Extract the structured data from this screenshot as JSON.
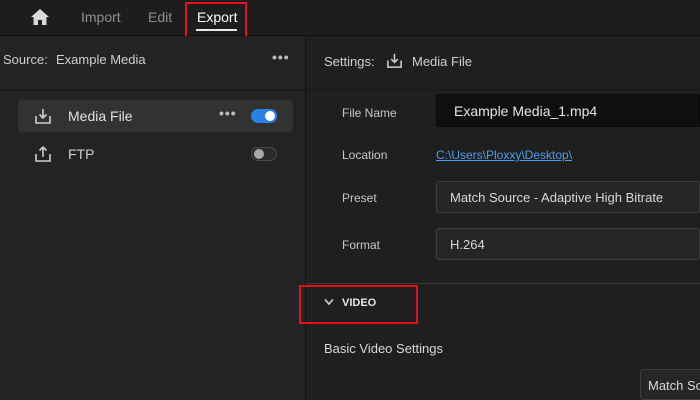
{
  "nav": {
    "home_icon": "home-icon",
    "import_label": "Import",
    "edit_label": "Edit",
    "export_label": "Export"
  },
  "source": {
    "label": "Source:",
    "value": "Example Media",
    "more": "•••"
  },
  "destinations": [
    {
      "label": "Media File",
      "icon": "download-icon",
      "enabled": true,
      "more": "•••"
    },
    {
      "label": "FTP",
      "icon": "upload-icon",
      "enabled": false
    }
  ],
  "settings": {
    "label": "Settings:",
    "destination": "Media File",
    "file_name_label": "File Name",
    "file_name_value": "Example Media_1.mp4",
    "location_label": "Location",
    "location_value": "C:\\Users\\Ploxxy\\Desktop\\",
    "preset_label": "Preset",
    "preset_value": "Match Source - Adaptive High Bitrate",
    "format_label": "Format",
    "format_value": "H.264"
  },
  "video": {
    "section_label": "VIDEO",
    "basic_settings_label": "Basic Video Settings",
    "match_value": "Match Source"
  },
  "colors": {
    "accent": "#2b80e6",
    "link": "#4a9ef0",
    "highlight": "#e3101a"
  }
}
